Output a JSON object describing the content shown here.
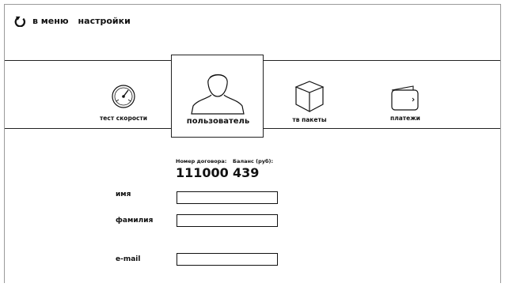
{
  "header": {
    "back_label": "в меню",
    "title": "настройки"
  },
  "nav": {
    "tabs": [
      {
        "id": "speed",
        "label": "тест скорости",
        "icon": "speedometer-icon"
      },
      {
        "id": "user",
        "label": "пользователь",
        "icon": "user-icon",
        "active": true
      },
      {
        "id": "tv",
        "label": "тв пакеты",
        "icon": "tv-box-icon"
      },
      {
        "id": "pay",
        "label": "платежи",
        "icon": "wallet-icon"
      }
    ]
  },
  "account": {
    "contract_caption": "Номер договора:",
    "contract_number": "111000",
    "balance_caption": "Баланс (руб):",
    "balance_value": "439"
  },
  "form": {
    "name_label": "имя",
    "name_value": "",
    "surname_label": "фамилия",
    "surname_value": "",
    "email_label": "e-mail",
    "email_value": ""
  },
  "colors": {
    "line": "#222222",
    "frame": "#9a9a9a"
  }
}
